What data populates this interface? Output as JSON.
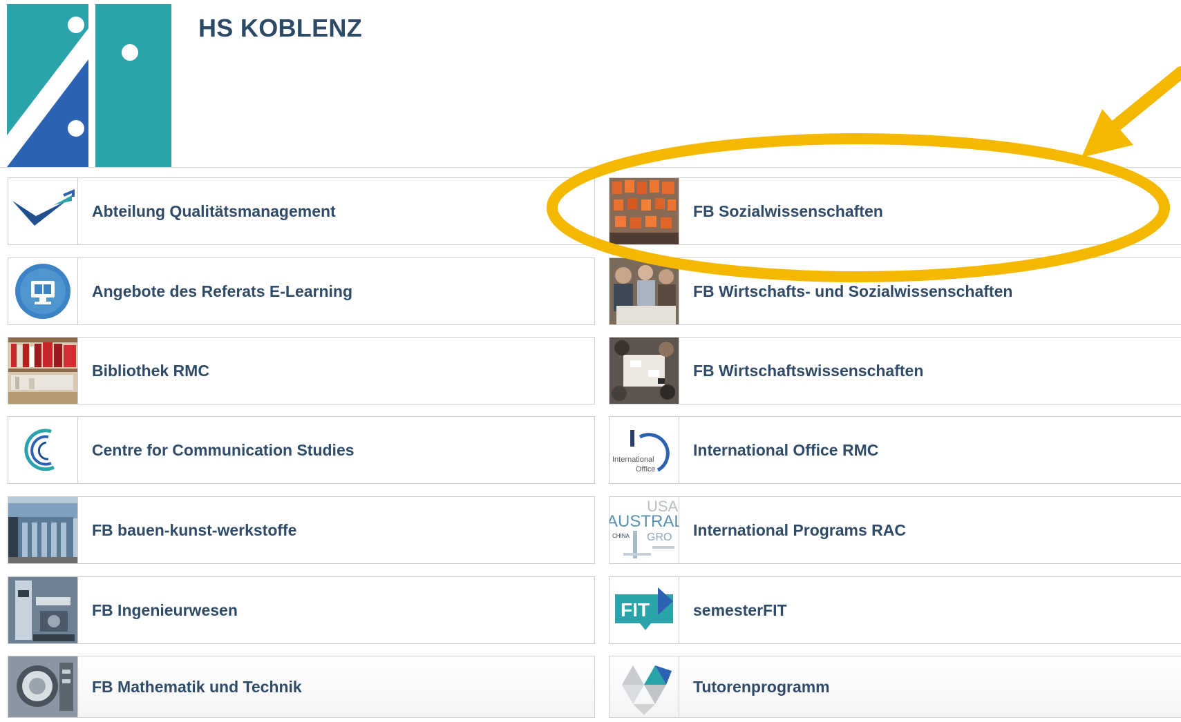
{
  "header": {
    "title": "HS KOBLENZ"
  },
  "left_column": [
    {
      "label": "Abteilung Qualitätsmanagement",
      "icon": "qm-logo-icon"
    },
    {
      "label": "Angebote des Referats E-Learning",
      "icon": "elearning-monitor-icon"
    },
    {
      "label": "Bibliothek RMC",
      "icon": "library-shelves-image"
    },
    {
      "label": "Centre for Communication Studies",
      "icon": "communication-swirl-icon"
    },
    {
      "label": "FB bauen-kunst-werkstoffe",
      "icon": "building-image"
    },
    {
      "label": "FB Ingenieurwesen",
      "icon": "machinery-image"
    },
    {
      "label": "FB Mathematik und Technik",
      "icon": "engine-image"
    }
  ],
  "right_column": [
    {
      "label": "FB Sozialwissenschaften",
      "icon": "group-photo-image"
    },
    {
      "label": "FB Wirtschafts- und Sozialwissenschaften",
      "icon": "students-photo-image"
    },
    {
      "label": "FB Wirtschaftswissenschaften",
      "icon": "meeting-photo-image"
    },
    {
      "label": "International Office RMC",
      "icon": "international-office-logo"
    },
    {
      "label": "International Programs RAC",
      "icon": "word-cloud-image"
    },
    {
      "label": "semesterFIT",
      "icon": "fit-logo-icon"
    },
    {
      "label": "Tutorenprogramm",
      "icon": "triangles-logo-icon"
    }
  ],
  "thumb_text": {
    "international_office": [
      "International",
      "Office"
    ],
    "word_cloud": [
      "USA",
      "AUSTRAL",
      "CHINA",
      "GRO"
    ],
    "fit": "FIT"
  },
  "colors": {
    "teal": "#2aa3aa",
    "blue": "#2b63b2",
    "title": "#2c4a66",
    "label": "#2f4b68",
    "highlight": "#f5b800"
  }
}
